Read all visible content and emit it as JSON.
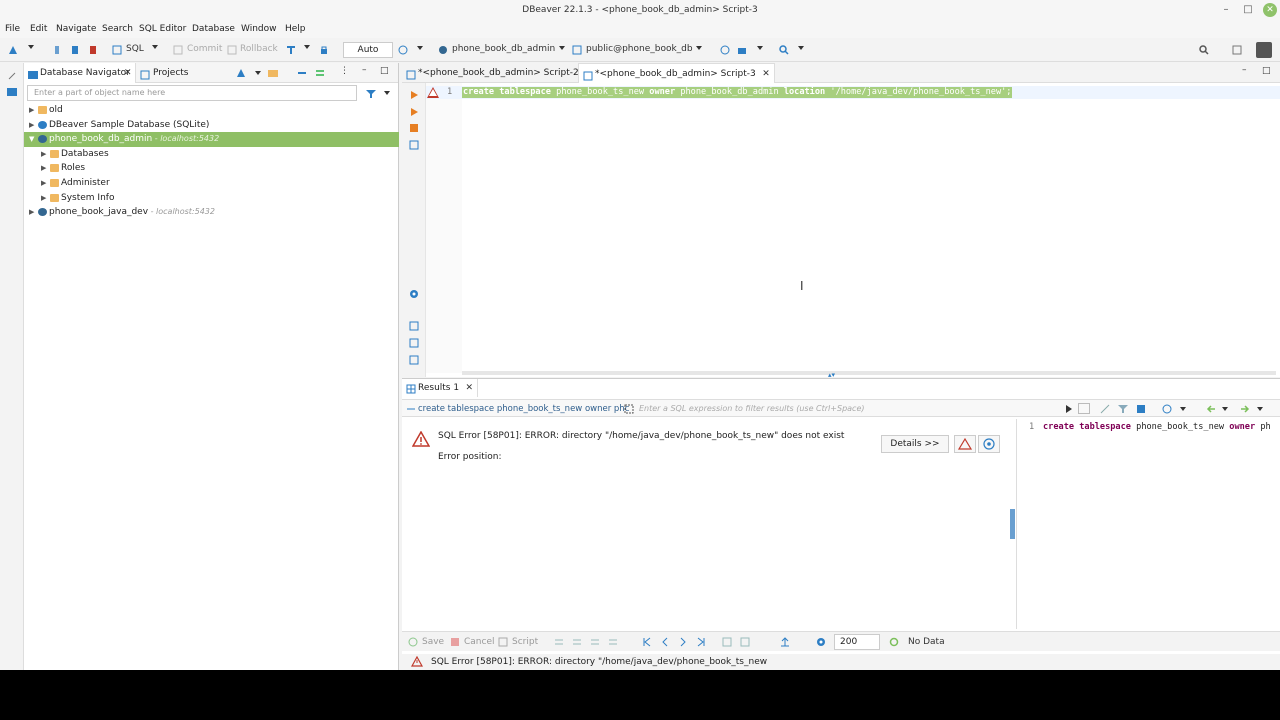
{
  "window": {
    "title": "DBeaver 22.1.3 - <phone_book_db_admin> Script-3",
    "controls": {
      "minimize": "–",
      "maximize": "□",
      "close": "✕"
    }
  },
  "menu": [
    "File",
    "Edit",
    "Navigate",
    "Search",
    "SQL Editor",
    "Database",
    "Window",
    "Help"
  ],
  "toolbar": {
    "sql_label": "SQL",
    "commit_label": "Commit",
    "rollback_label": "Rollback",
    "transaction_mode": "Auto",
    "active_connection": "phone_book_db_admin",
    "active_schema": "public@phone_book_db"
  },
  "navigator": {
    "tabs": [
      "Database Navigator",
      "Projects"
    ],
    "filter_placeholder": "Enter a part of object name here",
    "tree": [
      {
        "label": "old",
        "sub": "",
        "level": 0,
        "expanded": false,
        "selected": false,
        "icon": "folder-icon"
      },
      {
        "label": "DBeaver Sample Database (SQLite)",
        "sub": "",
        "level": 0,
        "expanded": false,
        "selected": false,
        "icon": "sqlite-icon"
      },
      {
        "label": "phone_book_db_admin",
        "sub": " - localhost:5432",
        "level": 0,
        "expanded": true,
        "selected": true,
        "icon": "postgres-icon"
      },
      {
        "label": "Databases",
        "sub": "",
        "level": 1,
        "expanded": false,
        "selected": false,
        "icon": "folder-icon"
      },
      {
        "label": "Roles",
        "sub": "",
        "level": 1,
        "expanded": false,
        "selected": false,
        "icon": "folder-icon"
      },
      {
        "label": "Administer",
        "sub": "",
        "level": 1,
        "expanded": false,
        "selected": false,
        "icon": "folder-icon"
      },
      {
        "label": "System Info",
        "sub": "",
        "level": 1,
        "expanded": false,
        "selected": false,
        "icon": "folder-icon"
      },
      {
        "label": "phone_book_java_dev",
        "sub": " - localhost:5432",
        "level": 0,
        "expanded": false,
        "selected": false,
        "icon": "postgres-icon"
      }
    ]
  },
  "editor": {
    "tabs": [
      {
        "label": "*<phone_book_db_admin> Script-2",
        "active": false
      },
      {
        "label": "*<phone_book_db_admin> Script-3",
        "active": true
      }
    ],
    "line_number": "1",
    "code": {
      "kw1": "create tablespace",
      "t1": " phone_book_ts_new ",
      "kw2": "owner",
      "t2": " phone_book_db_admin ",
      "kw3": "location",
      "t3": " '/home/java_dev/phone_book_ts_new';"
    }
  },
  "results": {
    "tab_label": "Results 1",
    "query_preview": "create tablespace phone_book_ts_new owner phc",
    "filter_placeholder": "Enter a SQL expression to filter results (use Ctrl+Space)",
    "error_message": "SQL Error [58P01]: ERROR: directory \"/home/java_dev/phone_book_ts_new\" does not exist",
    "error_position": "Error position:",
    "details_label": "Details >>",
    "query_pane": {
      "line_number": "1",
      "kw1": "create tablespace",
      "t1": " phone_book_ts_new ",
      "kw2": "owner",
      "t2": " ph"
    },
    "bottom": {
      "save_label": "Save",
      "cancel_label": "Cancel",
      "script_label": "Script",
      "fetch_size": "200",
      "no_data_label": "No Data"
    }
  },
  "status": {
    "message": "SQL Error [58P01]: ERROR: directory \"/home/java_dev/phone_book_ts_new"
  },
  "colors": {
    "selection_green": "#8fbf65",
    "code_highlight": "#a7cf7f",
    "error_red": "#c0392b",
    "accent_blue": "#2d7ec4"
  }
}
